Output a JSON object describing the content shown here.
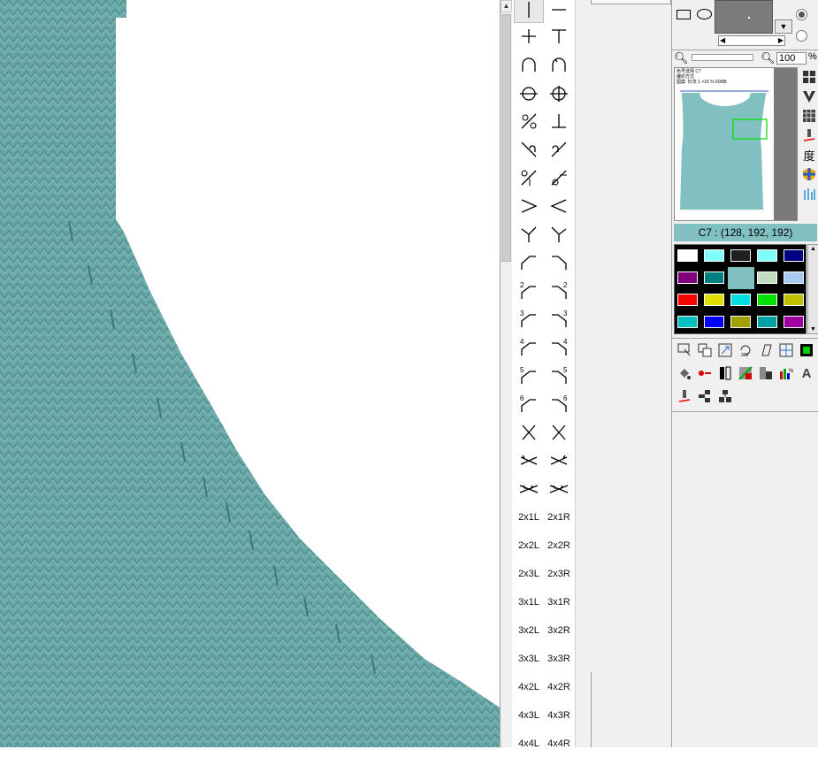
{
  "canvas": {
    "fabric_color": "#6aa8a8",
    "fabric_dark": "#4f8f8f",
    "background": "#ffffff"
  },
  "symbols": {
    "text_rows": [
      [
        "2x1L",
        "2x1R"
      ],
      [
        "2x2L",
        "2x2R"
      ],
      [
        "2x3L",
        "2x3R"
      ],
      [
        "3x1L",
        "3x1R"
      ],
      [
        "3x2L",
        "3x2R"
      ],
      [
        "3x3L",
        "3x3R"
      ],
      [
        "4x2L",
        "4x2R"
      ],
      [
        "4x3L",
        "4x3R"
      ],
      [
        "4x4L",
        "4x4R"
      ]
    ],
    "numbered_decreases": [
      "2",
      "3",
      "4",
      "5",
      "6"
    ]
  },
  "right_panel": {
    "zoom": {
      "value": "100",
      "unit": "%"
    },
    "navigator": {
      "info_lines": [
        "色号选择 C7",
        "编织方式",
        "图案: 针法 1 ×16 % 60/88"
      ],
      "garment_color": "#80c0c0",
      "view_box_color": "#00dd00"
    },
    "current_color_label": "C7 : (128, 192, 192)",
    "side_icon_char": "度",
    "swatches": [
      "#ffffff",
      "#80ffff",
      "#202020",
      "#80ffff",
      "#000080",
      "#800080",
      "#008080",
      "#80c0c0",
      "#c0dcc0",
      "#a6caf0",
      "#ff0000",
      "#e0e000",
      "#00e0e0",
      "#00e000",
      "#c0c000",
      "#00c0c0",
      "#0000ff",
      "#a0a000",
      "#00a0a0",
      "#a000a0"
    ],
    "selected_swatch": 7,
    "tools_row2_text": "A"
  }
}
